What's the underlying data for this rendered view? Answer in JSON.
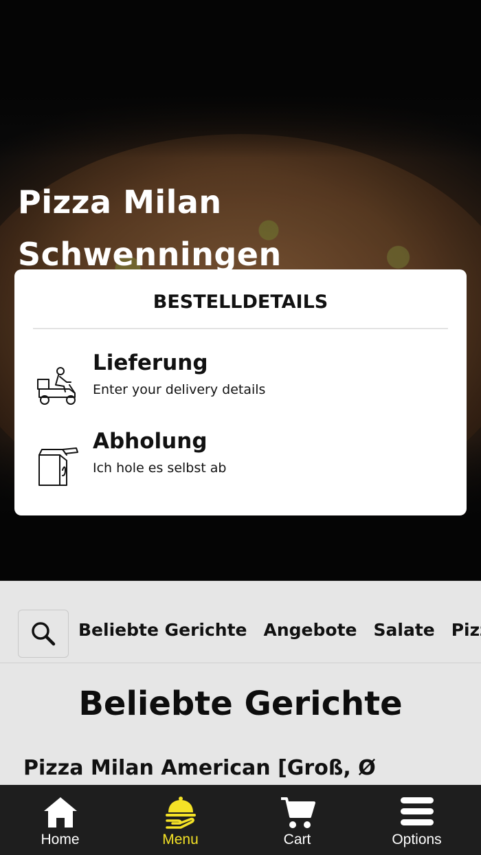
{
  "restaurant": {
    "name": "Pizza Milan Schwenningen"
  },
  "order_details": {
    "heading": "BESTELLDETAILS",
    "options": [
      {
        "icon": "delivery-scooter-icon",
        "title": "Lieferung",
        "subtitle": "Enter your delivery details"
      },
      {
        "icon": "takeaway-bag-icon",
        "title": "Abholung",
        "subtitle": "Ich hole es selbst ab"
      }
    ]
  },
  "categories": [
    "Beliebte Gerichte",
    "Angebote",
    "Salate",
    "Pizza"
  ],
  "section": {
    "title": "Beliebte Gerichte",
    "first_item": "Pizza Milan American [Groß, Ø"
  },
  "nav": {
    "items": [
      {
        "label": "Home",
        "icon": "home-icon"
      },
      {
        "label": "Menu",
        "icon": "serving-dish-icon",
        "active": true
      },
      {
        "label": "Cart",
        "icon": "cart-icon"
      },
      {
        "label": "Options",
        "icon": "menu-bars-icon"
      }
    ],
    "accent_color": "#f4e226"
  }
}
